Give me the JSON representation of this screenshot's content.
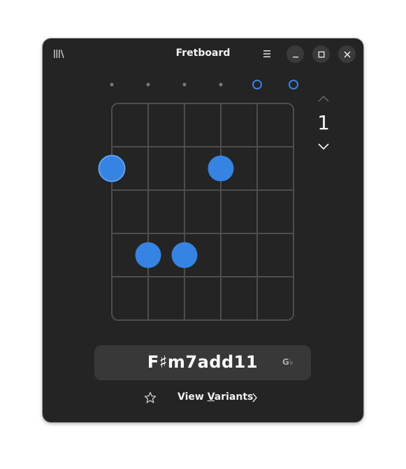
{
  "window": {
    "title": "Fretboard"
  },
  "fretboard": {
    "string_markers": [
      "dot",
      "dot",
      "dot",
      "dot",
      "open",
      "open"
    ],
    "dots": [
      {
        "string": 1,
        "fret": 2,
        "style": "outlined"
      },
      {
        "string": 4,
        "fret": 2,
        "style": "filled"
      },
      {
        "string": 2,
        "fret": 4,
        "style": "filled"
      },
      {
        "string": 3,
        "fret": 4,
        "style": "filled"
      }
    ],
    "accent": "#3584e4"
  },
  "position": {
    "fret": "1"
  },
  "chord": {
    "name": "F♯m7add11",
    "alternate": "G♭"
  },
  "footer": {
    "variants_pre": "View ",
    "variants_mnemonic": "V",
    "variants_post": "ariants"
  }
}
